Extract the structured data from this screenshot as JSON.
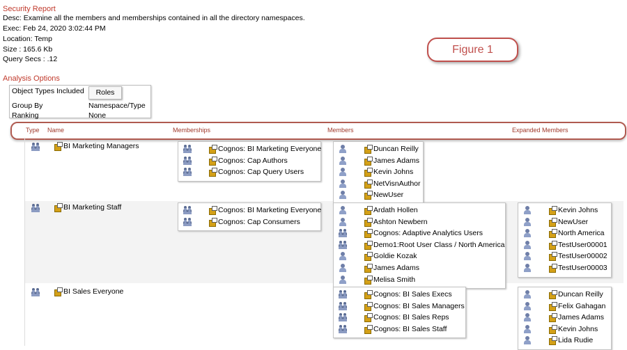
{
  "report": {
    "title": "Security Report",
    "desc": "Desc: Examine all the members and memberships contained in all the directory namespaces.",
    "exec": "Exec: Feb 24, 2020 3:02:44 PM",
    "location": "Location: Temp",
    "size": "Size :  165.6 Kb",
    "query_secs": "Query Secs :  .12"
  },
  "figure_label": "Figure 1",
  "analysis": {
    "title": "Analysis Options",
    "object_types_label": "Object Types Included",
    "roles_button": "Roles",
    "group_by_label": "Group By",
    "group_by_value": "Namespace/Type",
    "ranking_label": "Ranking",
    "ranking_value": "None"
  },
  "columns": {
    "type": "Type",
    "name": "Name",
    "memberships": "Memberships",
    "members": "Members",
    "expanded": "Expanded Members"
  },
  "rows": [
    {
      "name": "BI Marketing Managers",
      "memberships": [
        "Cognos: BI Marketing Everyone",
        "Cognos: Cap Authors",
        "Cognos: Cap Query Users"
      ],
      "members": [
        {
          "icon": "user",
          "label": "Duncan Reilly"
        },
        {
          "icon": "user",
          "label": "James Adams"
        },
        {
          "icon": "user",
          "label": "Kevin Johns"
        },
        {
          "icon": "user",
          "label": "NetVisnAuthor"
        },
        {
          "icon": "user",
          "label": "NewUser"
        }
      ],
      "expanded": []
    },
    {
      "name": "BI Marketing Staff",
      "memberships": [
        "Cognos: BI Marketing Everyone",
        "Cognos: Cap Consumers"
      ],
      "members": [
        {
          "icon": "user",
          "label": "Ardath Hollen"
        },
        {
          "icon": "user",
          "label": "Ashton Newbern"
        },
        {
          "icon": "group",
          "label": "Cognos: Adaptive Analytics Users"
        },
        {
          "icon": "group",
          "label": "Demo1:Root User Class / North America"
        },
        {
          "icon": "user",
          "label": "Goldie Kozak"
        },
        {
          "icon": "user",
          "label": "James Adams"
        },
        {
          "icon": "user",
          "label": "Melisa Smith"
        }
      ],
      "expanded": [
        {
          "icon": "user",
          "label": "Kevin Johns"
        },
        {
          "icon": "user",
          "label": "NewUser"
        },
        {
          "icon": "user",
          "label": "North America"
        },
        {
          "icon": "user",
          "label": "TestUser00001"
        },
        {
          "icon": "user",
          "label": "TestUser00002"
        },
        {
          "icon": "user",
          "label": "TestUser00003"
        }
      ]
    },
    {
      "name": "BI Sales Everyone",
      "memberships": [],
      "members": [
        {
          "icon": "group",
          "label": "Cognos: BI Sales Execs"
        },
        {
          "icon": "group",
          "label": "Cognos: BI Sales Managers"
        },
        {
          "icon": "group",
          "label": "Cognos: BI Sales Reps"
        },
        {
          "icon": "group",
          "label": "Cognos: BI Sales Staff"
        }
      ],
      "expanded": [
        {
          "icon": "user",
          "label": "Duncan Reilly"
        },
        {
          "icon": "user",
          "label": "Felix Gahagan"
        },
        {
          "icon": "user",
          "label": "James Adams"
        },
        {
          "icon": "user",
          "label": "Kevin Johns"
        },
        {
          "icon": "user",
          "label": "Lida Rudie"
        }
      ]
    }
  ]
}
